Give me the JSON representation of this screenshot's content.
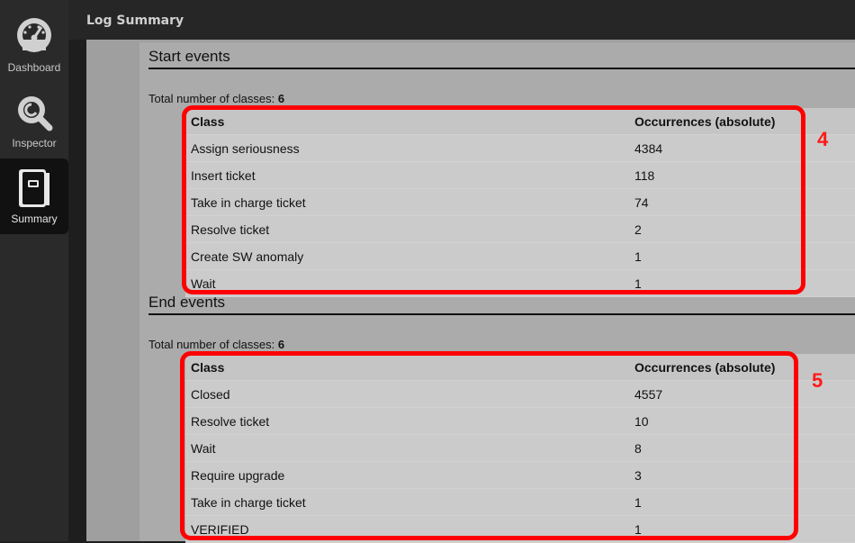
{
  "nav": {
    "dashboard": "Dashboard",
    "inspector": "Inspector",
    "summary": "Summary"
  },
  "header": {
    "title": "Log Summary"
  },
  "start_events": {
    "title": "Start events",
    "total_label": "Total number of classes:",
    "total_value": "6",
    "columns": [
      "Class",
      "Occurrences (absolute)"
    ],
    "rows": [
      [
        "Assign seriousness",
        "4384"
      ],
      [
        "Insert ticket",
        "118"
      ],
      [
        "Take in charge ticket",
        "74"
      ],
      [
        "Resolve ticket",
        "2"
      ],
      [
        "Create SW anomaly",
        "1"
      ],
      [
        "Wait",
        "1"
      ]
    ],
    "annotation": "4"
  },
  "end_events": {
    "title": "End events",
    "total_label": "Total number of classes:",
    "total_value": "6",
    "columns": [
      "Class",
      "Occurrences (absolute)"
    ],
    "rows": [
      [
        "Closed",
        "4557"
      ],
      [
        "Resolve ticket",
        "10"
      ],
      [
        "Wait",
        "8"
      ],
      [
        "Require upgrade",
        "3"
      ],
      [
        "Take in charge ticket",
        "1"
      ],
      [
        "VERIFIED",
        "1"
      ]
    ],
    "annotation": "5"
  },
  "colors": {
    "highlight": "#ff0000",
    "annotation": "#ff1a1a"
  }
}
